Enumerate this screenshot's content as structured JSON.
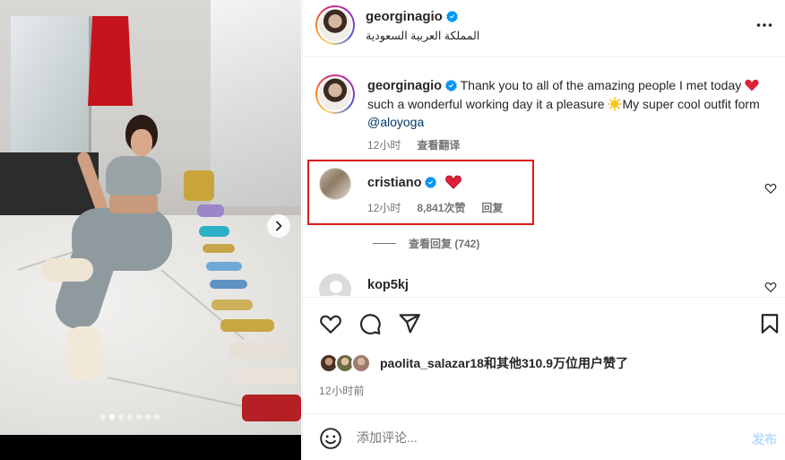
{
  "post": {
    "author": "georginagio",
    "location": "المملكة العربية السعودية",
    "carousel": {
      "count": 7,
      "active_index": 1
    }
  },
  "caption": {
    "author": "georginagio",
    "text_1": "Thank you to all of the amazing people I met today",
    "text_2": "such a wonderful working day it a pleasure",
    "text_3": "My super cool outfit form",
    "mention": "@aloyoga",
    "time": "12小时",
    "translate": "查看翻译"
  },
  "comments": [
    {
      "author": "cristiano",
      "time": "12小时",
      "likes": "8,841次赞",
      "reply": "回复",
      "view_replies": "查看回复 (742)"
    },
    {
      "author": "kop5kj"
    }
  ],
  "actions": {
    "likes_user": "paolita_salazar18",
    "likes_summary": "和其他310.9万位用户赞了",
    "timestamp": "12小时前"
  },
  "comment_box": {
    "placeholder": "添加评论...",
    "post_label": "发布"
  },
  "colors": {
    "verified": "#0095f6",
    "heart_red": "#ed4956",
    "post_button": "#b3dbff",
    "highlight": "#d81c1c"
  }
}
